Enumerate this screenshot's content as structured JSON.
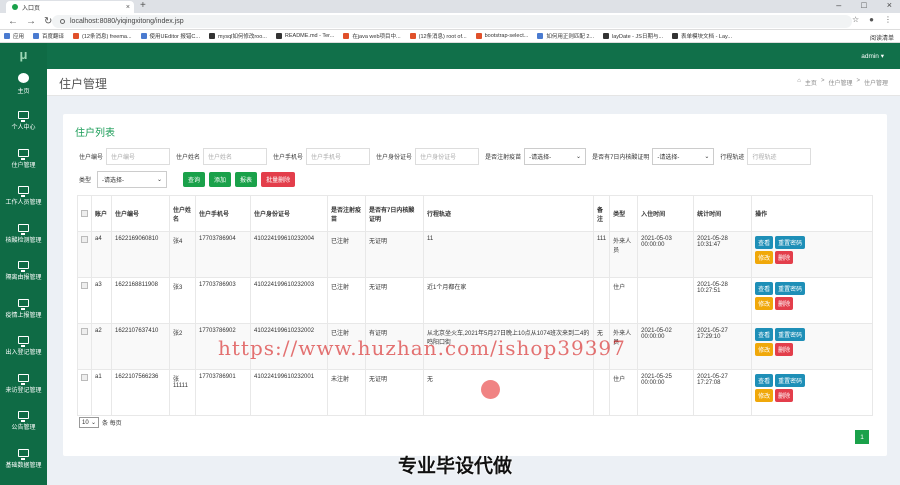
{
  "browser": {
    "tab_title": "入口页",
    "url": "localhost:8080/yiqingxitong/index.jsp",
    "bookmarks": [
      "应用",
      "百度翻译",
      "(12条消息) freema...",
      "使用UEditor 报错C...",
      "mysql如何修改roo...",
      "README.md - Ter...",
      "在java web项目中...",
      "(12条消息) root of...",
      "bootstrap-select...",
      "如何用正则匹配 2...",
      "layDate - JS日期与...",
      "表单模块文档 - Lay..."
    ],
    "reading_list": "阅读清单"
  },
  "sidebar": {
    "logo": "μ",
    "items": [
      {
        "label": "主页",
        "icon": "home-icon"
      },
      {
        "label": "个人中心",
        "icon": "monitor-icon"
      },
      {
        "label": "住户管理",
        "icon": "monitor-icon"
      },
      {
        "label": "工作人员管理",
        "icon": "monitor-icon"
      },
      {
        "label": "核酸检测管理",
        "icon": "monitor-icon"
      },
      {
        "label": "隔离由报管理",
        "icon": "monitor-icon"
      },
      {
        "label": "疫情上报管理",
        "icon": "monitor-icon"
      },
      {
        "label": "出入登记管理",
        "icon": "monitor-icon"
      },
      {
        "label": "来访登记管理",
        "icon": "monitor-icon"
      },
      {
        "label": "公告管理",
        "icon": "monitor-icon"
      },
      {
        "label": "基础数据管理",
        "icon": "monitor-icon"
      }
    ]
  },
  "topnav": {
    "user": "admin ▾"
  },
  "header": {
    "title": "住户管理",
    "breadcrumb": [
      "主页",
      ">",
      "住户管理",
      ">",
      "住户管理"
    ]
  },
  "panel": {
    "title": "住户列表"
  },
  "filters": {
    "no_label": "住户编号",
    "no_placeholder": "住户编号",
    "name_label": "住户姓名",
    "name_placeholder": "住户姓名",
    "phone_label": "住户手机号",
    "phone_placeholder": "住户手机号",
    "id_label": "住户身份证号",
    "id_placeholder": "住户身份证号",
    "reg_label": "是否注射疫苗",
    "reg_value": "-请选择-",
    "cert_label": "是否有7日内核酸证明",
    "cert_value": "-请选择-",
    "trip_label": "行程轨迹",
    "trip_placeholder": "行程轨迹",
    "type_label": "类型",
    "type_value": "-请选择-"
  },
  "actions": {
    "search": "查询",
    "add": "添加",
    "report": "报表",
    "batch_delete": "批量删除"
  },
  "table": {
    "headers": [
      "",
      "账户",
      "住户编号",
      "住户姓名",
      "住户手机号",
      "住户身份证号",
      "是否注射疫苗",
      "是否有7日内核酸证明",
      "行程轨迹",
      "备注",
      "类型",
      "入住时间",
      "统计时间",
      "操作"
    ],
    "rows": [
      {
        "acc": "a4",
        "no": "1622169060810",
        "name": "张4",
        "phone": "17703786904",
        "idno": "410224199610232004",
        "reg": "已注射",
        "cert": "无证明",
        "trip": "11",
        "note": "111",
        "type": "外来人员",
        "checkin": "2021-05-03 00:00:00",
        "stat": "2021-05-28 10:31:47"
      },
      {
        "acc": "a3",
        "no": "1622168811908",
        "name": "张3",
        "phone": "17703786903",
        "idno": "410224199610232003",
        "reg": "已注射",
        "cert": "无证明",
        "trip": "近1个月都在家",
        "note": "",
        "type": "住户",
        "checkin": "",
        "stat": "2021-05-28 10:27:51"
      },
      {
        "acc": "a2",
        "no": "1622107637410",
        "name": "张2",
        "phone": "17703786902",
        "idno": "410224199610232002",
        "reg": "已注射",
        "cert": "有证明",
        "trip": "从北京坐火车,2021年5月27日晚上10点从1074班次来到二4的鸣阳口街",
        "note": "无",
        "type": "外来人员",
        "checkin": "2021-05-02 00:00:00",
        "stat": "2021-05-27 17:29:10"
      },
      {
        "acc": "a1",
        "no": "1622107566236",
        "name": "张11111",
        "phone": "17703786901",
        "idno": "410224199610232001",
        "reg": "未注射",
        "cert": "无证明",
        "trip": "无",
        "note": "",
        "type": "住户",
        "checkin": "2021-05-25 00:00:00",
        "stat": "2021-05-27 17:27:08"
      }
    ],
    "ops": {
      "view": "查看",
      "reset": "重置密码",
      "edit": "修改",
      "delete": "删除"
    }
  },
  "pager": {
    "size": "10",
    "suffix": "条 每页",
    "page": "1"
  },
  "overlay": {
    "watermark": "https://www.huzhan.com/ishop39397",
    "caption": "专业毕设代做"
  }
}
